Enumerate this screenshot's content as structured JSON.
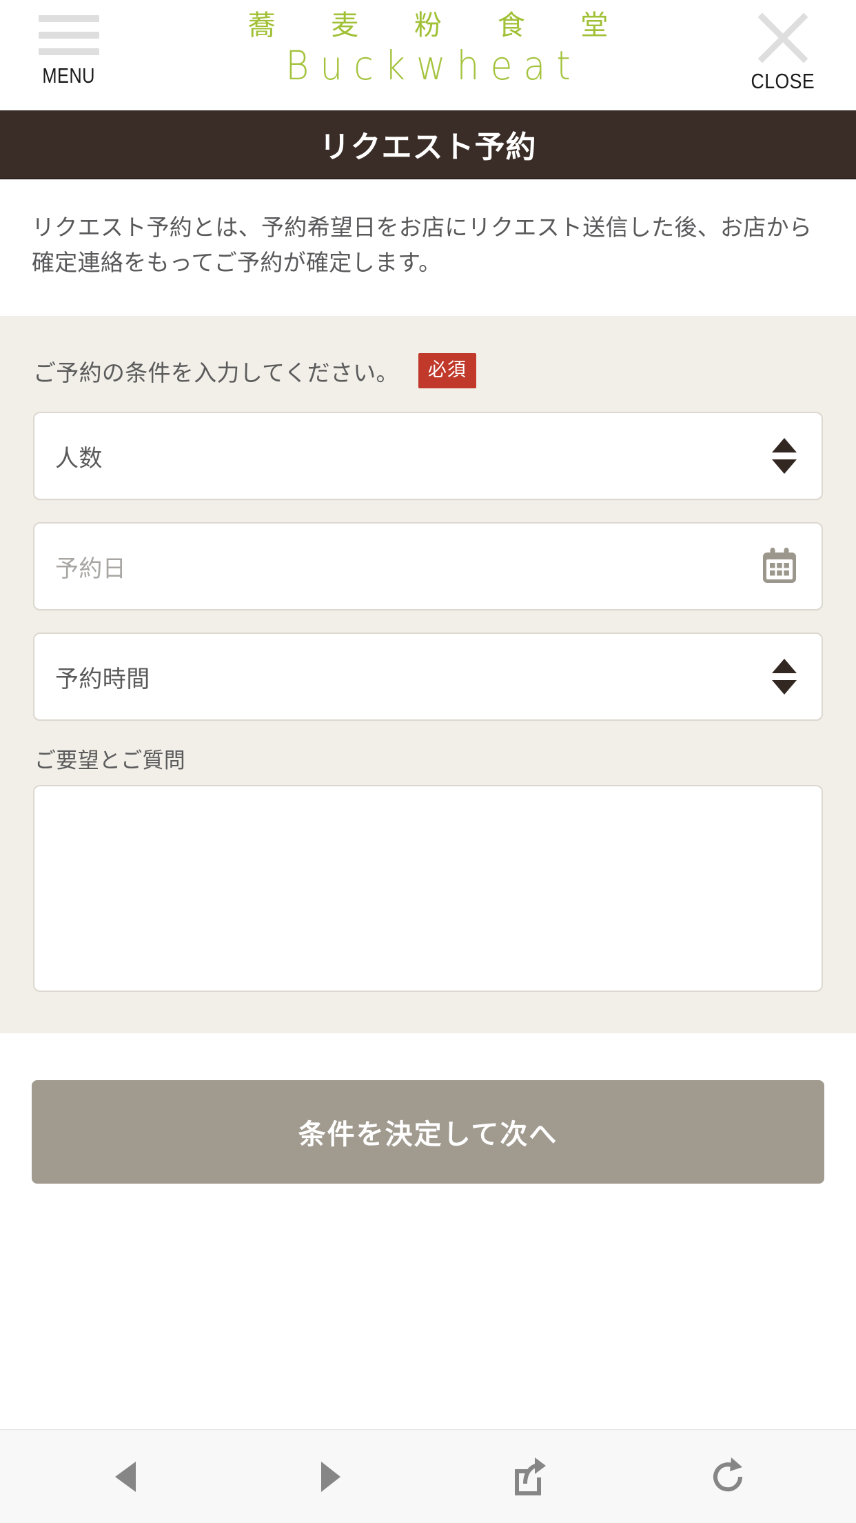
{
  "header": {
    "menu_label": "MENU",
    "close_label": "CLOSE",
    "logo_jp": "蕎 麦 粉 食 堂",
    "logo_en": "Buckwheat",
    "brand_color": "#a0c035"
  },
  "page": {
    "title": "リクエスト予約",
    "title_bar_color": "#3a2c26",
    "lead": "リクエスト予約とは、予約希望日をお店にリクエスト送信した後、お店から確定連絡をもってご予約が確定します。"
  },
  "form": {
    "section_label": "ご予約の条件を入力してください。",
    "required_badge": "必須",
    "required_badge_color": "#c0392b",
    "background_color": "#f2efe8",
    "party_size": {
      "value": "人数",
      "icon": "stepper-updown-icon"
    },
    "reservation_date": {
      "placeholder": "予約日",
      "value": "",
      "icon": "calendar-icon"
    },
    "reservation_time": {
      "value": "予約時間",
      "icon": "stepper-updown-icon"
    },
    "requests": {
      "label": "ご要望とご質問",
      "value": ""
    }
  },
  "submit": {
    "label": "条件を決定して次へ",
    "color": "#a09a8f"
  },
  "browser_toolbar": {
    "buttons": [
      {
        "name": "back-icon",
        "label": "戻る"
      },
      {
        "name": "forward-icon",
        "label": "進む"
      },
      {
        "name": "share-icon",
        "label": "共有"
      },
      {
        "name": "reload-icon",
        "label": "再読み込み"
      }
    ]
  }
}
